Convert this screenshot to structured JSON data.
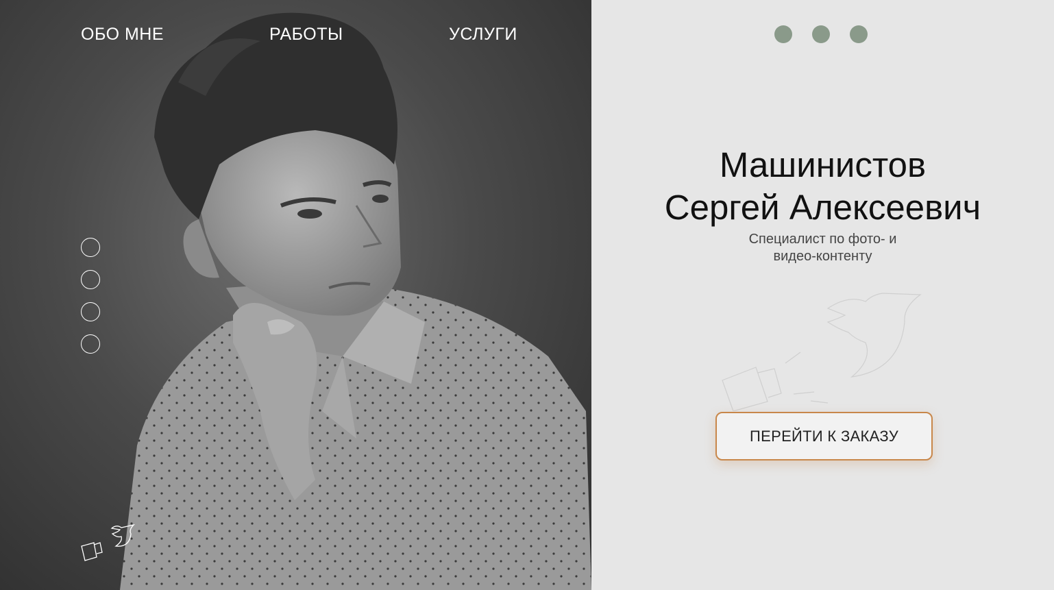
{
  "nav": {
    "about": "ОБО МНЕ",
    "works": "РАБОТЫ",
    "services": "УСЛУГИ"
  },
  "hero": {
    "name_line1": "Машинистов",
    "name_line2": "Сергей Алексеевич",
    "subtitle_line1": "Специалист по фото- и",
    "subtitle_line2": "видео-контенту",
    "cta_label": "ПЕРЕЙТИ К ЗАКАЗУ"
  },
  "icons": {
    "menu": "three-dot-menu-icon",
    "logo": "bird-camera-logo-icon"
  },
  "colors": {
    "accent": "#c8874a",
    "menu_dots": "#8a9a8a",
    "right_bg": "#e6e6e6"
  }
}
